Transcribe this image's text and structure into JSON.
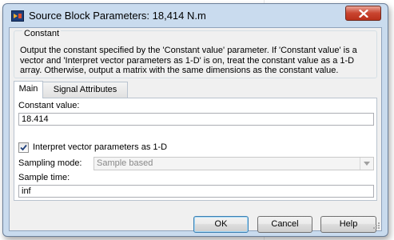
{
  "window": {
    "title": "Source Block Parameters: 18,414 N.m",
    "icon": "simulink-block-icon",
    "close_icon": "close-icon"
  },
  "block": {
    "group_title": "Constant",
    "description": "Output the constant specified by the 'Constant value' parameter. If 'Constant value' is a vector and 'Interpret vector parameters as 1-D' is on, treat the constant value as a 1-D array. Otherwise, output a matrix with the same dimensions as the constant value."
  },
  "tabs": [
    {
      "label": "Main",
      "active": true
    },
    {
      "label": "Signal Attributes",
      "active": false
    }
  ],
  "main": {
    "constant_value_label": "Constant value:",
    "constant_value": "18.414",
    "interpret_label": "Interpret vector parameters as 1-D",
    "interpret_checked": true,
    "sampling_mode_label": "Sampling mode:",
    "sampling_mode_value": "Sample based",
    "sampling_mode_enabled": false,
    "sample_time_label": "Sample time:",
    "sample_time_value": "inf"
  },
  "buttons": {
    "ok": "OK",
    "cancel": "Cancel",
    "help": "Help"
  },
  "colors": {
    "frame": "#c9dbee",
    "client": "#f0f0f0",
    "close_button": "#c9442f",
    "default_button_border": "#3c7fb1"
  }
}
